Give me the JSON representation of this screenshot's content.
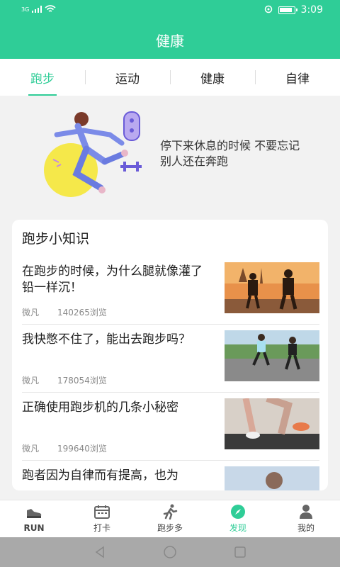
{
  "status": {
    "network": "3G",
    "time": "3:09"
  },
  "header": {
    "title": "健康"
  },
  "tabs": [
    {
      "label": "跑步",
      "active": true
    },
    {
      "label": "运动",
      "active": false
    },
    {
      "label": "健康",
      "active": false
    },
    {
      "label": "自律",
      "active": false
    }
  ],
  "hero": {
    "text": "停下来休息的时候 不要忘记别人还在奔跑"
  },
  "knowledge": {
    "title": "跑步小知识",
    "articles": [
      {
        "title": "在跑步的时候，为什么腿就像灌了铅一样沉！",
        "author": "微凡",
        "views": "140265浏览"
      },
      {
        "title": "我快憋不住了，能出去跑步吗？",
        "author": "微凡",
        "views": "178054浏览"
      },
      {
        "title": "正确使用跑步机的几条小秘密",
        "author": "微凡",
        "views": "199640浏览"
      },
      {
        "title": "跑者因为自律而有提高，也为",
        "author": "",
        "views": ""
      }
    ]
  },
  "tabbar": [
    {
      "label": "RUN",
      "icon": "shoe-icon",
      "active": false
    },
    {
      "label": "打卡",
      "icon": "calendar-icon",
      "active": false
    },
    {
      "label": "跑步多",
      "icon": "runner-icon",
      "active": false
    },
    {
      "label": "发现",
      "icon": "compass-icon",
      "active": true
    },
    {
      "label": "我的",
      "icon": "user-icon",
      "active": false
    }
  ],
  "colors": {
    "accent": "#2fcd97"
  }
}
